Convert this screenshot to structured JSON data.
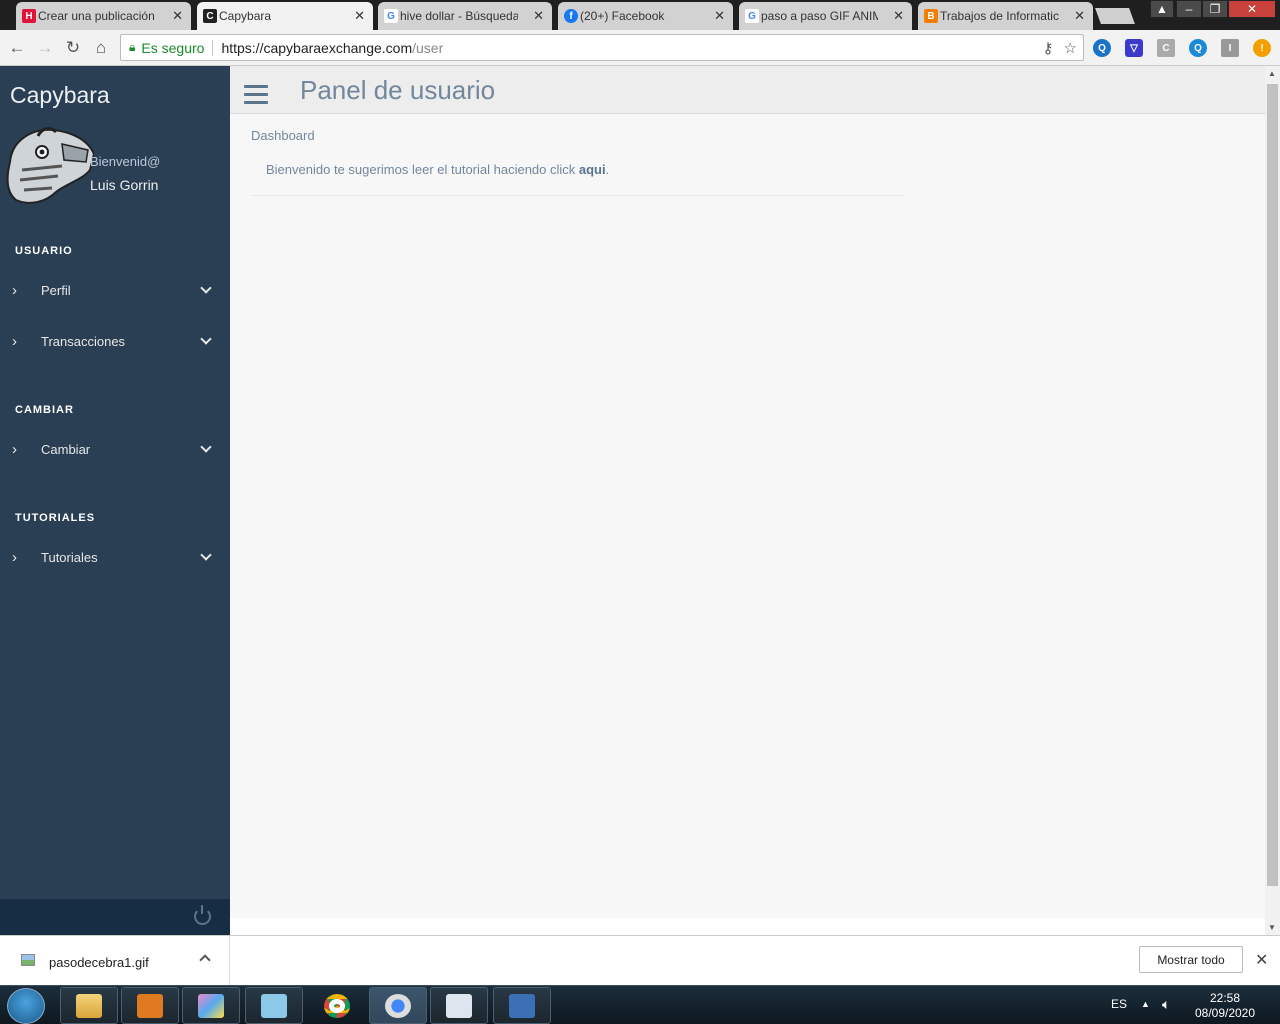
{
  "browser": {
    "tabs": [
      {
        "title": "Crear una publicación",
        "favicon": "hive-icon",
        "active": false
      },
      {
        "title": "Capybara",
        "favicon": "capybara-icon",
        "active": true
      },
      {
        "title": "hive dollar - Búsqueda",
        "favicon": "google-icon",
        "active": false
      },
      {
        "title": "(20+) Facebook",
        "favicon": "facebook-icon",
        "active": false
      },
      {
        "title": "paso a paso GIF ANIM",
        "favicon": "google-icon",
        "active": false
      },
      {
        "title": "Trabajos de Informatic",
        "favicon": "blogger-icon",
        "active": false
      }
    ],
    "tab_close": "✕",
    "security_label": "Es seguro",
    "url_host": "https://capybaraexchange.com",
    "url_path": "/user"
  },
  "sidebar": {
    "brand": "Capybara",
    "welcome": "Bienvenid@",
    "username": "Luis Gorrin",
    "sections": [
      {
        "title": "USUARIO",
        "items": [
          {
            "label": "Perfil"
          },
          {
            "label": "Transacciones"
          }
        ]
      },
      {
        "title": "CAMBIAR",
        "items": [
          {
            "label": "Cambiar"
          }
        ]
      },
      {
        "title": "TUTORIALES",
        "items": [
          {
            "label": "Tutoriales"
          }
        ]
      }
    ]
  },
  "main": {
    "page_title": "Panel de usuario",
    "breadcrumb": "Dashboard",
    "welcome_text": "Bienvenido te sugerimos leer el tutorial haciendo click ",
    "welcome_link": "aqui",
    "welcome_end": "."
  },
  "downloads": {
    "filename": "pasodecebra1.gif",
    "show_all": "Mostrar todo",
    "close": "✕"
  },
  "taskbar": {
    "language": "ES",
    "time": "22:58",
    "date": "08/09/2020"
  },
  "colors": {
    "sidebar": "#2a3f54",
    "sidebar_footer": "#172d44",
    "main_bg": "#f7f7f7",
    "title_text": "#73879c"
  }
}
